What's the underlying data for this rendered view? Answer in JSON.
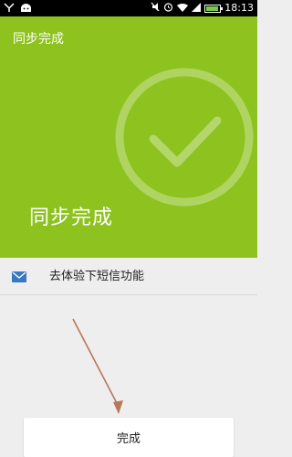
{
  "status_bar": {
    "time": "18:13",
    "battery_level": 0.9,
    "icons": [
      "usb-debug-icon",
      "android-icon",
      "mute-icon",
      "alarm-icon",
      "wifi-icon",
      "signal-icon",
      "battery-icon"
    ]
  },
  "header": {
    "title": "同步完成",
    "big_title": "同步完成",
    "background": "#8dc21f"
  },
  "list": {
    "items": [
      {
        "label": "去体验下短信功能",
        "icon": "mail-icon"
      }
    ]
  },
  "footer": {
    "done_label": "完成"
  }
}
